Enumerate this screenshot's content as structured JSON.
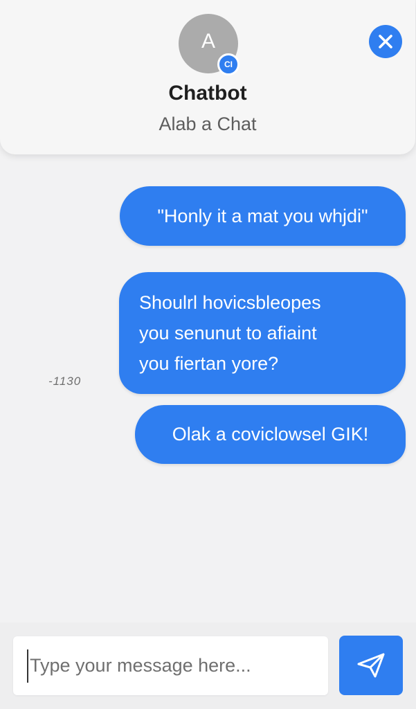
{
  "header": {
    "avatar_letter": "A",
    "badge_text": "CI",
    "title": "Chatbot",
    "subtitle": "Alab a Chat",
    "close_icon": "close-icon"
  },
  "messages": [
    {
      "sender": "user",
      "lines": [
        "\"Honly it a mat you whjdi\""
      ]
    },
    {
      "sender": "user",
      "lines": [
        "Shoulrl hovicsbleopes",
        "you senunut to afiaint",
        "you fiertan yore?"
      ]
    },
    {
      "sender": "user",
      "lines": [
        "Olak a coviclowsel GIK!"
      ]
    }
  ],
  "timestamp": "-1130",
  "composer": {
    "placeholder": "Type your message here...",
    "value": "",
    "send_icon": "send-icon"
  },
  "colors": {
    "accent": "#2f7ef0",
    "background": "#f2f2f3",
    "header_bg": "#f6f6f6",
    "avatar_bg": "#ababab"
  }
}
